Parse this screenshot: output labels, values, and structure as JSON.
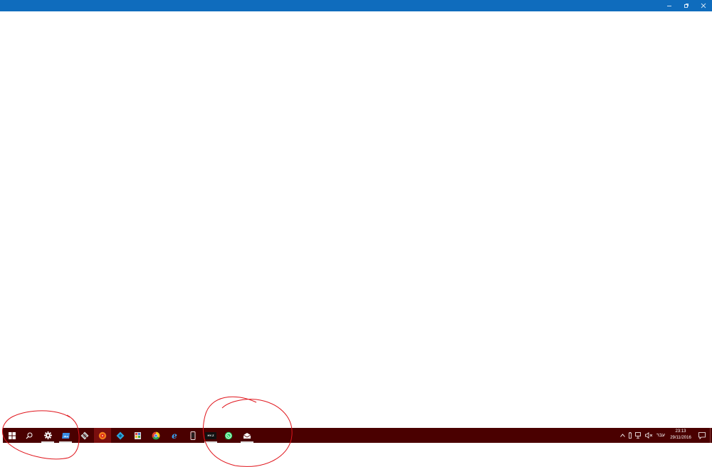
{
  "colors": {
    "titlebar": "#0f6cbd",
    "taskbar": "#4a0000",
    "taskbar_active": "#7a0e0e",
    "annotation": "#e0151c"
  },
  "titlebar": {
    "buttons": [
      "minimize-icon",
      "maximize-icon",
      "close-icon"
    ]
  },
  "taskbar": {
    "pinned": [
      {
        "name": "start-button",
        "icon": "windows-logo-icon",
        "running": false
      },
      {
        "name": "search-button",
        "icon": "search-icon",
        "running": false
      },
      {
        "name": "settings-app",
        "icon": "gear-icon",
        "running": true
      },
      {
        "name": "photos-app",
        "icon": "photo-icon",
        "running": true
      },
      {
        "name": "sketch-app",
        "icon": "diamond-pen-icon",
        "running": false
      },
      {
        "name": "media-app",
        "icon": "media-icon",
        "running": false,
        "active": true
      },
      {
        "name": "kodi-app",
        "icon": "kodi-icon",
        "running": false
      },
      {
        "name": "paint-app",
        "icon": "paint-icon",
        "running": false
      },
      {
        "name": "chrome-app",
        "icon": "chrome-icon",
        "running": false
      },
      {
        "name": "edge-app",
        "icon": "edge-icon",
        "running": false
      },
      {
        "name": "phone-app",
        "icon": "phone-icon",
        "running": false
      },
      {
        "name": "hyz-app",
        "icon": "hyz-icon",
        "running": true
      },
      {
        "name": "whatsapp-app",
        "icon": "whatsapp-icon",
        "running": false
      },
      {
        "name": "mail-app",
        "icon": "mail-icon",
        "running": true
      }
    ],
    "hyz_label": "HY-Z",
    "tray": {
      "language": "עבר",
      "time": "23:13",
      "date": "29/11/2016"
    }
  }
}
